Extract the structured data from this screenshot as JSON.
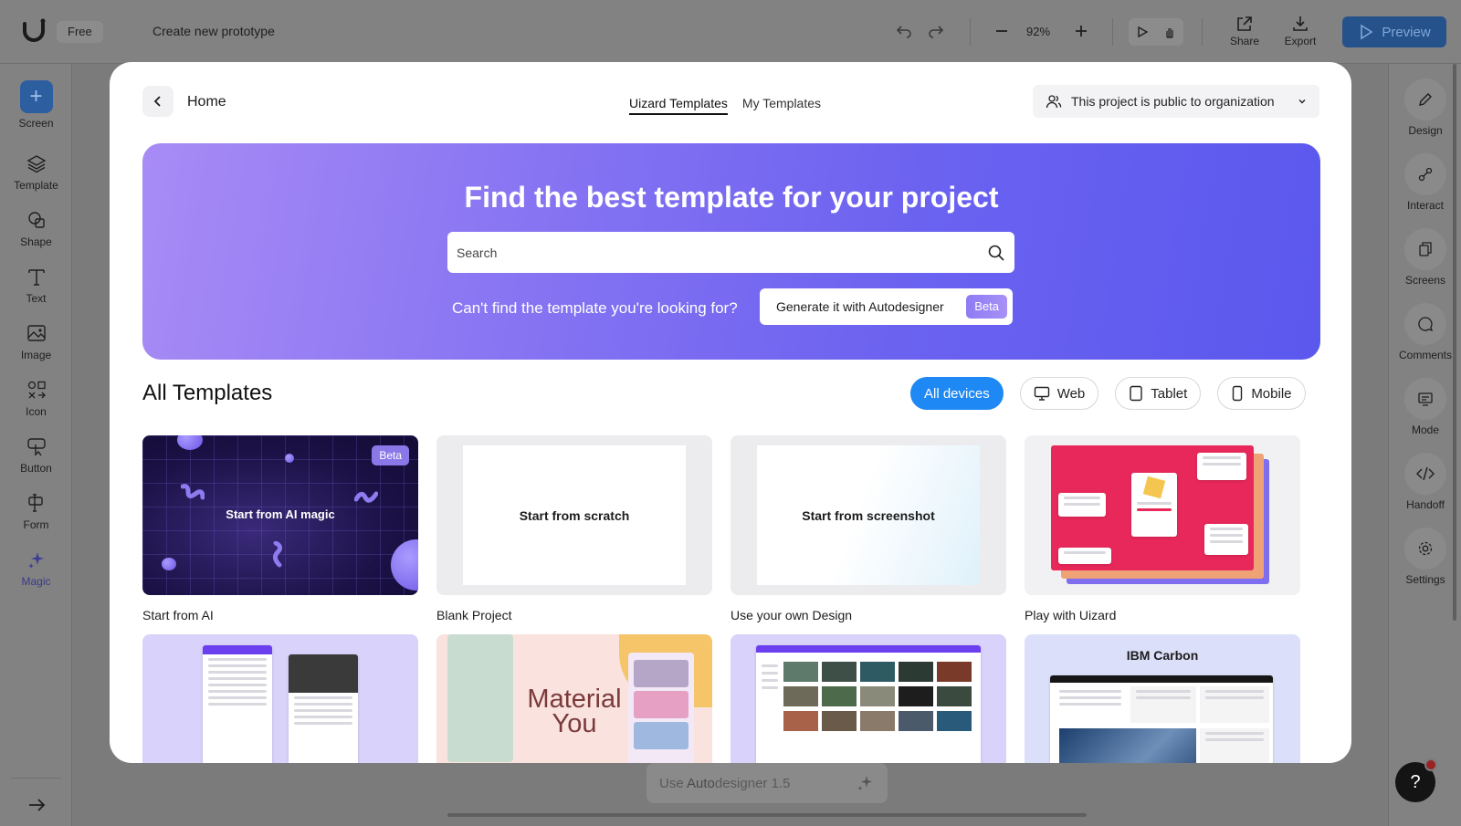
{
  "topbar": {
    "plan": "Free",
    "project_title": "Create new prototype",
    "zoom": "92%",
    "share_label": "Share",
    "export_label": "Export",
    "preview_label": "Preview"
  },
  "left_sidebar": {
    "items": [
      {
        "label": "Screen",
        "icon": "plus-icon"
      },
      {
        "label": "Template",
        "icon": "layers-icon"
      },
      {
        "label": "Shape",
        "icon": "shapes-icon"
      },
      {
        "label": "Text",
        "icon": "text-icon"
      },
      {
        "label": "Image",
        "icon": "image-icon"
      },
      {
        "label": "Icon",
        "icon": "icons-icon"
      },
      {
        "label": "Button",
        "icon": "cursor-button-icon"
      },
      {
        "label": "Form",
        "icon": "form-icon"
      },
      {
        "label": "Magic",
        "icon": "sparkle-icon"
      }
    ]
  },
  "right_sidebar": {
    "items": [
      {
        "label": "Design",
        "icon": "pencil-icon"
      },
      {
        "label": "Interact",
        "icon": "link-nodes-icon"
      },
      {
        "label": "Screens",
        "icon": "copy-icon"
      },
      {
        "label": "Comments",
        "icon": "comment-icon"
      },
      {
        "label": "Mode",
        "icon": "monitor-icon"
      },
      {
        "label": "Handoff",
        "icon": "code-icon"
      },
      {
        "label": "Settings",
        "icon": "gear-icon"
      }
    ]
  },
  "autodesigner_bar": {
    "prefix": "Use ",
    "bold": "Auto",
    "suffix": "designer 1.5"
  },
  "help": {
    "label": "?"
  },
  "modal": {
    "back_label": "Home",
    "tabs": [
      {
        "label": "Uizard Templates",
        "active": true
      },
      {
        "label": "My Templates",
        "active": false
      }
    ],
    "visibility": "This project is public to organization",
    "hero": {
      "title": "Find the best template for your project",
      "search_placeholder": "Search",
      "cta_text": "Can't find the template you're looking for?",
      "generate_label": "Generate it with Autodesigner",
      "beta_label": "Beta"
    },
    "section_title": "All Templates",
    "filters": [
      {
        "label": "All devices",
        "active": true,
        "icon": ""
      },
      {
        "label": "Web",
        "active": false,
        "icon": "monitor-icon"
      },
      {
        "label": "Tablet",
        "active": false,
        "icon": "tablet-icon"
      },
      {
        "label": "Mobile",
        "active": false,
        "icon": "phone-icon"
      }
    ],
    "cards": [
      {
        "label": "Start from AI",
        "thumb_text": "Start from AI magic",
        "badge": "Beta"
      },
      {
        "label": "Blank Project",
        "thumb_text": "Start from scratch"
      },
      {
        "label": "Use your own Design",
        "thumb_text": "Start from screenshot"
      },
      {
        "label": "Play with Uizard",
        "thumb_text": ""
      }
    ],
    "row2_cards": [
      {
        "thumb_text": ""
      },
      {
        "thumb_text": "Material You"
      },
      {
        "thumb_text": ""
      },
      {
        "thumb_text": "IBM Carbon"
      }
    ]
  },
  "colors": {
    "accent": "#1e88f5",
    "hero_start": "#a88bf5",
    "hero_end": "#5b58ee",
    "play_pink": "#e8285a"
  }
}
